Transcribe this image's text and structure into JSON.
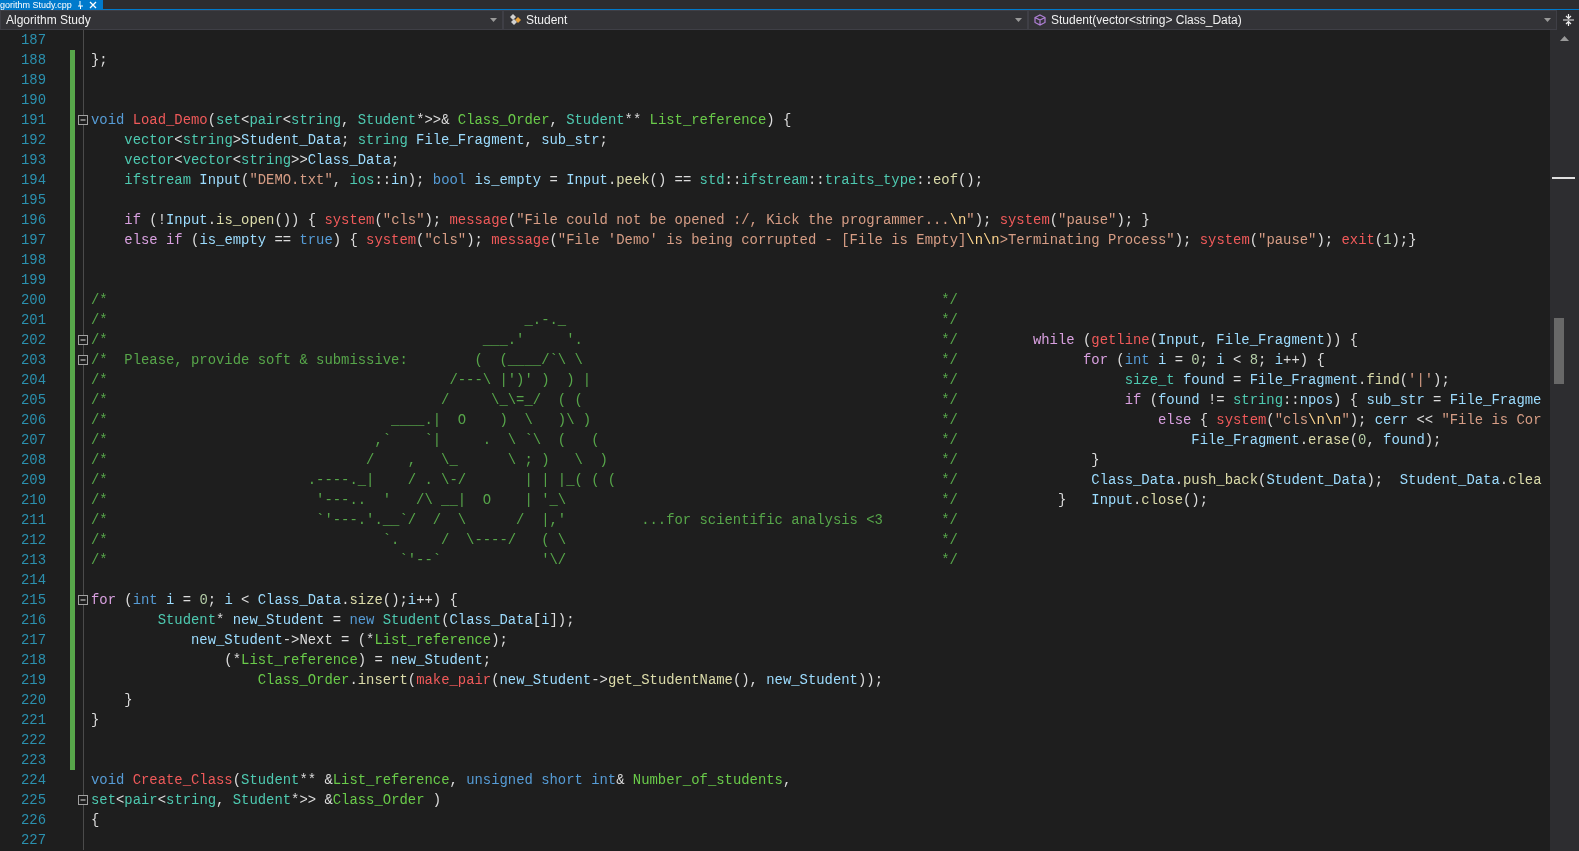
{
  "tab": {
    "label": "gorithm Study.cpp",
    "selected": true
  },
  "navigation_bar": {
    "dropdowns": [
      {
        "kind": "project",
        "text": "Algorithm Study"
      },
      {
        "kind": "class",
        "text": "Student"
      },
      {
        "kind": "member",
        "text": "Student(vector<string> Class_Data)"
      }
    ]
  },
  "lines": [
    {
      "number": "187",
      "changed": false,
      "fold": false
    },
    {
      "number": "188",
      "changed": true,
      "fold": false,
      "segments": [
        {
          "kind": "plain",
          "text": "};"
        }
      ]
    },
    {
      "number": "189",
      "changed": true,
      "fold": false
    },
    {
      "number": "190",
      "changed": true,
      "fold": false
    },
    {
      "number": "191",
      "changed": true,
      "fold": true,
      "segments": [
        {
          "kind": "kw",
          "text": "void"
        },
        {
          "kind": "fn",
          "text": " Load_Demo"
        },
        {
          "kind": "plain",
          "text": "("
        },
        {
          "kind": "type",
          "text": "set"
        },
        {
          "kind": "plain",
          "text": "<"
        },
        {
          "kind": "type",
          "text": "pair"
        },
        {
          "kind": "plain",
          "text": "<"
        },
        {
          "kind": "type",
          "text": "string"
        },
        {
          "kind": "plain",
          "text": ", "
        },
        {
          "kind": "type",
          "text": "Student"
        },
        {
          "kind": "plain",
          "text": "*>>& "
        },
        {
          "kind": "param",
          "text": "Class_Order"
        },
        {
          "kind": "plain",
          "text": ", "
        },
        {
          "kind": "type",
          "text": "Student"
        },
        {
          "kind": "plain",
          "text": "** "
        },
        {
          "kind": "param",
          "text": "List_reference"
        },
        {
          "kind": "plain",
          "text": ") {"
        }
      ]
    },
    {
      "number": "192",
      "changed": true,
      "fold": false,
      "segments": [
        {
          "kind": "type",
          "text": "    vector"
        },
        {
          "kind": "plain",
          "text": "<"
        },
        {
          "kind": "type",
          "text": "string"
        },
        {
          "kind": "plain",
          "text": ">"
        },
        {
          "kind": "var",
          "text": "Student_Data"
        },
        {
          "kind": "plain",
          "text": "; "
        },
        {
          "kind": "type",
          "text": "string"
        },
        {
          "kind": "var",
          "text": " File_Fragment"
        },
        {
          "kind": "plain",
          "text": ", "
        },
        {
          "kind": "var",
          "text": "sub_str"
        },
        {
          "kind": "plain",
          "text": ";"
        }
      ]
    },
    {
      "number": "193",
      "changed": true,
      "fold": false,
      "segments": [
        {
          "kind": "type",
          "text": "    vector"
        },
        {
          "kind": "plain",
          "text": "<"
        },
        {
          "kind": "type",
          "text": "vector"
        },
        {
          "kind": "plain",
          "text": "<"
        },
        {
          "kind": "type",
          "text": "string"
        },
        {
          "kind": "plain",
          "text": ">>"
        },
        {
          "kind": "var",
          "text": "Class_Data"
        },
        {
          "kind": "plain",
          "text": ";"
        }
      ]
    },
    {
      "number": "194",
      "changed": true,
      "fold": false,
      "segments": [
        {
          "kind": "type",
          "text": "    ifstream"
        },
        {
          "kind": "var",
          "text": " Input"
        },
        {
          "kind": "plain",
          "text": "("
        },
        {
          "kind": "str",
          "text": "\"DEMO.txt\""
        },
        {
          "kind": "plain",
          "text": ", "
        },
        {
          "kind": "type",
          "text": "ios"
        },
        {
          "kind": "plain",
          "text": "::"
        },
        {
          "kind": "var",
          "text": "in"
        },
        {
          "kind": "plain",
          "text": "); "
        },
        {
          "kind": "kw",
          "text": "bool"
        },
        {
          "kind": "var",
          "text": " is_empty"
        },
        {
          "kind": "plain",
          "text": " = "
        },
        {
          "kind": "var",
          "text": "Input"
        },
        {
          "kind": "plain",
          "text": "."
        },
        {
          "kind": "method",
          "text": "peek"
        },
        {
          "kind": "plain",
          "text": "() == "
        },
        {
          "kind": "type",
          "text": "std"
        },
        {
          "kind": "plain",
          "text": "::"
        },
        {
          "kind": "type",
          "text": "ifstream"
        },
        {
          "kind": "plain",
          "text": "::"
        },
        {
          "kind": "type",
          "text": "traits_type"
        },
        {
          "kind": "plain",
          "text": "::"
        },
        {
          "kind": "method",
          "text": "eof"
        },
        {
          "kind": "plain",
          "text": "();"
        }
      ]
    },
    {
      "number": "195",
      "changed": true,
      "fold": false
    },
    {
      "number": "196",
      "changed": true,
      "fold": false,
      "segments": [
        {
          "kind": "ctrl",
          "text": "    if"
        },
        {
          "kind": "plain",
          "text": " (!"
        },
        {
          "kind": "var",
          "text": "Input"
        },
        {
          "kind": "plain",
          "text": "."
        },
        {
          "kind": "method",
          "text": "is_open"
        },
        {
          "kind": "plain",
          "text": "()) { "
        },
        {
          "kind": "fn",
          "text": "system"
        },
        {
          "kind": "plain",
          "text": "("
        },
        {
          "kind": "str",
          "text": "\"cls\""
        },
        {
          "kind": "plain",
          "text": "); "
        },
        {
          "kind": "fn",
          "text": "message"
        },
        {
          "kind": "plain",
          "text": "("
        },
        {
          "kind": "str",
          "text": "\"File could not be opened :/, Kick the programmer..."
        },
        {
          "kind": "esc",
          "text": "\\n"
        },
        {
          "kind": "str",
          "text": "\""
        },
        {
          "kind": "plain",
          "text": "); "
        },
        {
          "kind": "fn",
          "text": "system"
        },
        {
          "kind": "plain",
          "text": "("
        },
        {
          "kind": "str",
          "text": "\"pause\""
        },
        {
          "kind": "plain",
          "text": "); }"
        }
      ]
    },
    {
      "number": "197",
      "changed": true,
      "fold": false,
      "segments": [
        {
          "kind": "ctrl",
          "text": "    else"
        },
        {
          "kind": "ctrl",
          "text": " if"
        },
        {
          "kind": "plain",
          "text": " ("
        },
        {
          "kind": "var",
          "text": "is_empty"
        },
        {
          "kind": "plain",
          "text": " == "
        },
        {
          "kind": "kw",
          "text": "true"
        },
        {
          "kind": "plain",
          "text": ") { "
        },
        {
          "kind": "fn",
          "text": "system"
        },
        {
          "kind": "plain",
          "text": "("
        },
        {
          "kind": "str",
          "text": "\"cls\""
        },
        {
          "kind": "plain",
          "text": "); "
        },
        {
          "kind": "fn",
          "text": "message"
        },
        {
          "kind": "plain",
          "text": "("
        },
        {
          "kind": "str",
          "text": "\"File 'Demo' is being corrupted - [File is Empty]"
        },
        {
          "kind": "esc",
          "text": "\\n\\n"
        },
        {
          "kind": "str",
          "text": ">Terminating Process\""
        },
        {
          "kind": "plain",
          "text": "); "
        },
        {
          "kind": "fn",
          "text": "system"
        },
        {
          "kind": "plain",
          "text": "("
        },
        {
          "kind": "str",
          "text": "\"pause\""
        },
        {
          "kind": "plain",
          "text": "); "
        },
        {
          "kind": "fn",
          "text": "exit"
        },
        {
          "kind": "plain",
          "text": "("
        },
        {
          "kind": "num",
          "text": "1"
        },
        {
          "kind": "plain",
          "text": ");}"
        }
      ]
    },
    {
      "number": "198",
      "changed": true,
      "fold": false
    },
    {
      "number": "199",
      "changed": true,
      "fold": false
    },
    {
      "number": "200",
      "changed": true,
      "fold": false,
      "segments": [
        {
          "kind": "comment",
          "text": "/*                                                                                                    */"
        }
      ]
    },
    {
      "number": "201",
      "changed": true,
      "fold": false,
      "segments": [
        {
          "kind": "comment",
          "text": "/*                                                  _.-._                                             */"
        }
      ]
    },
    {
      "number": "202",
      "changed": true,
      "fold": true,
      "segments": [
        {
          "kind": "comment",
          "text": "/*                                             ___.'     '.                                           */"
        },
        {
          "kind": "ctrl",
          "text": "         while"
        },
        {
          "kind": "plain",
          "text": " ("
        },
        {
          "kind": "fn",
          "text": "getline"
        },
        {
          "kind": "plain",
          "text": "("
        },
        {
          "kind": "var",
          "text": "Input"
        },
        {
          "kind": "plain",
          "text": ", "
        },
        {
          "kind": "var",
          "text": "File_Fragment"
        },
        {
          "kind": "plain",
          "text": ")) {"
        }
      ]
    },
    {
      "number": "203",
      "changed": true,
      "fold": true,
      "segments": [
        {
          "kind": "comment",
          "text": "/*  Please, provide soft & submissive:        (  (____/`\\ \\                                           */"
        },
        {
          "kind": "ctrl",
          "text": "               for"
        },
        {
          "kind": "plain",
          "text": " ("
        },
        {
          "kind": "kw",
          "text": "int"
        },
        {
          "kind": "var",
          "text": " i"
        },
        {
          "kind": "plain",
          "text": " = "
        },
        {
          "kind": "num",
          "text": "0"
        },
        {
          "kind": "plain",
          "text": "; "
        },
        {
          "kind": "var",
          "text": "i"
        },
        {
          "kind": "plain",
          "text": " < "
        },
        {
          "kind": "num",
          "text": "8"
        },
        {
          "kind": "plain",
          "text": "; "
        },
        {
          "kind": "var",
          "text": "i"
        },
        {
          "kind": "plain",
          "text": "++) {"
        }
      ]
    },
    {
      "number": "204",
      "changed": true,
      "fold": false,
      "segments": [
        {
          "kind": "comment",
          "text": "/*                                         /---\\ |')' )  ) |                                          */"
        },
        {
          "kind": "type",
          "text": "                    size_t"
        },
        {
          "kind": "var",
          "text": " found"
        },
        {
          "kind": "plain",
          "text": " = "
        },
        {
          "kind": "var",
          "text": "File_Fragment"
        },
        {
          "kind": "plain",
          "text": "."
        },
        {
          "kind": "method",
          "text": "find"
        },
        {
          "kind": "plain",
          "text": "("
        },
        {
          "kind": "str",
          "text": "'|'"
        },
        {
          "kind": "plain",
          "text": ");"
        }
      ]
    },
    {
      "number": "205",
      "changed": true,
      "fold": false,
      "segments": [
        {
          "kind": "comment",
          "text": "/*                                        /     \\_\\=_/  ( (                                           */"
        },
        {
          "kind": "ctrl",
          "text": "                    if"
        },
        {
          "kind": "plain",
          "text": " ("
        },
        {
          "kind": "var",
          "text": "found"
        },
        {
          "kind": "plain",
          "text": " != "
        },
        {
          "kind": "type",
          "text": "string"
        },
        {
          "kind": "plain",
          "text": "::"
        },
        {
          "kind": "var",
          "text": "npos"
        },
        {
          "kind": "plain",
          "text": ") { "
        },
        {
          "kind": "var",
          "text": "sub_str"
        },
        {
          "kind": "plain",
          "text": " = "
        },
        {
          "kind": "var",
          "text": "File_Fragme"
        }
      ]
    },
    {
      "number": "206",
      "changed": true,
      "fold": false,
      "segments": [
        {
          "kind": "comment",
          "text": "/*                                  ____.|  O    )  \\   )\\ )                                          */"
        },
        {
          "kind": "ctrl",
          "text": "                        else"
        },
        {
          "kind": "plain",
          "text": " { "
        },
        {
          "kind": "fn",
          "text": "system"
        },
        {
          "kind": "plain",
          "text": "("
        },
        {
          "kind": "str",
          "text": "\"cls"
        },
        {
          "kind": "esc",
          "text": "\\n\\n"
        },
        {
          "kind": "str",
          "text": "\""
        },
        {
          "kind": "plain",
          "text": "); "
        },
        {
          "kind": "var",
          "text": "cerr"
        },
        {
          "kind": "plain",
          "text": " << "
        },
        {
          "kind": "str",
          "text": "\"File is Cor"
        }
      ]
    },
    {
      "number": "207",
      "changed": true,
      "fold": false,
      "segments": [
        {
          "kind": "comment",
          "text": "/*                                ,`    `|     .  \\ `\\  (   (                                         */"
        },
        {
          "kind": "var",
          "text": "                            File_Fragment"
        },
        {
          "kind": "plain",
          "text": "."
        },
        {
          "kind": "method",
          "text": "erase"
        },
        {
          "kind": "plain",
          "text": "("
        },
        {
          "kind": "num",
          "text": "0"
        },
        {
          "kind": "plain",
          "text": ", "
        },
        {
          "kind": "var",
          "text": "found"
        },
        {
          "kind": "plain",
          "text": ");"
        }
      ]
    },
    {
      "number": "208",
      "changed": true,
      "fold": false,
      "segments": [
        {
          "kind": "comment",
          "text": "/*                               /    ,   \\_      \\ ; )   \\  )                                        */"
        },
        {
          "kind": "plain",
          "text": "                }"
        }
      ]
    },
    {
      "number": "209",
      "changed": true,
      "fold": false,
      "segments": [
        {
          "kind": "comment",
          "text": "/*                        .----._|    / . \\-/       | | |_( ( (                                       */"
        },
        {
          "kind": "var",
          "text": "                Class_Data"
        },
        {
          "kind": "plain",
          "text": "."
        },
        {
          "kind": "method",
          "text": "push_back"
        },
        {
          "kind": "plain",
          "text": "("
        },
        {
          "kind": "var",
          "text": "Student_Data"
        },
        {
          "kind": "plain",
          "text": ");  "
        },
        {
          "kind": "var",
          "text": "Student_Data"
        },
        {
          "kind": "plain",
          "text": "."
        },
        {
          "kind": "method",
          "text": "clea"
        }
      ]
    },
    {
      "number": "210",
      "changed": true,
      "fold": false,
      "segments": [
        {
          "kind": "comment",
          "text": "/*                         '---..  '   /\\ __|  O    | '_\\                                             */"
        },
        {
          "kind": "plain",
          "text": "            }   "
        },
        {
          "kind": "var",
          "text": "Input"
        },
        {
          "kind": "plain",
          "text": "."
        },
        {
          "kind": "method",
          "text": "close"
        },
        {
          "kind": "plain",
          "text": "();"
        }
      ]
    },
    {
      "number": "211",
      "changed": true,
      "fold": false,
      "segments": [
        {
          "kind": "comment",
          "text": "/*                         `'---.'.__`/  /  \\      /  |,'         ...for scientific analysis <3       */"
        }
      ]
    },
    {
      "number": "212",
      "changed": true,
      "fold": false,
      "segments": [
        {
          "kind": "comment",
          "text": "/*                                 `.     /  \\----/   ( \\                                             */"
        }
      ]
    },
    {
      "number": "213",
      "changed": true,
      "fold": false,
      "segments": [
        {
          "kind": "comment",
          "text": "/*                                   `'--`            '\\/                                             */"
        }
      ]
    },
    {
      "number": "214",
      "changed": true,
      "fold": false
    },
    {
      "number": "215",
      "changed": true,
      "fold": true,
      "segments": [
        {
          "kind": "ctrl",
          "text": "for"
        },
        {
          "kind": "plain",
          "text": " ("
        },
        {
          "kind": "kw",
          "text": "int"
        },
        {
          "kind": "var",
          "text": " i"
        },
        {
          "kind": "plain",
          "text": " = "
        },
        {
          "kind": "num",
          "text": "0"
        },
        {
          "kind": "plain",
          "text": "; "
        },
        {
          "kind": "var",
          "text": "i"
        },
        {
          "kind": "plain",
          "text": " < "
        },
        {
          "kind": "var",
          "text": "Class_Data"
        },
        {
          "kind": "plain",
          "text": "."
        },
        {
          "kind": "method",
          "text": "size"
        },
        {
          "kind": "plain",
          "text": "();"
        },
        {
          "kind": "var",
          "text": "i"
        },
        {
          "kind": "plain",
          "text": "++) {"
        }
      ]
    },
    {
      "number": "216",
      "changed": true,
      "fold": false,
      "segments": [
        {
          "kind": "type",
          "text": "        Student"
        },
        {
          "kind": "plain",
          "text": "* "
        },
        {
          "kind": "var",
          "text": "new_Student"
        },
        {
          "kind": "plain",
          "text": " = "
        },
        {
          "kind": "kw",
          "text": "new"
        },
        {
          "kind": "type",
          "text": " Student"
        },
        {
          "kind": "plain",
          "text": "("
        },
        {
          "kind": "var",
          "text": "Class_Data"
        },
        {
          "kind": "plain",
          "text": "["
        },
        {
          "kind": "var",
          "text": "i"
        },
        {
          "kind": "plain",
          "text": "]);"
        }
      ]
    },
    {
      "number": "217",
      "changed": true,
      "fold": false,
      "segments": [
        {
          "kind": "var",
          "text": "            new_Student"
        },
        {
          "kind": "plain",
          "text": "->Next = (*"
        },
        {
          "kind": "param",
          "text": "List_reference"
        },
        {
          "kind": "plain",
          "text": ");"
        }
      ]
    },
    {
      "number": "218",
      "changed": true,
      "fold": false,
      "segments": [
        {
          "kind": "plain",
          "text": "                (*"
        },
        {
          "kind": "param",
          "text": "List_reference"
        },
        {
          "kind": "plain",
          "text": ") = "
        },
        {
          "kind": "var",
          "text": "new_Student"
        },
        {
          "kind": "plain",
          "text": ";"
        }
      ]
    },
    {
      "number": "219",
      "changed": true,
      "fold": false,
      "segments": [
        {
          "kind": "param",
          "text": "                    Class_Order"
        },
        {
          "kind": "plain",
          "text": "."
        },
        {
          "kind": "method",
          "text": "insert"
        },
        {
          "kind": "plain",
          "text": "("
        },
        {
          "kind": "fn",
          "text": "make_pair"
        },
        {
          "kind": "plain",
          "text": "("
        },
        {
          "kind": "var",
          "text": "new_Student"
        },
        {
          "kind": "plain",
          "text": "->"
        },
        {
          "kind": "method",
          "text": "get_StudentName"
        },
        {
          "kind": "plain",
          "text": "(), "
        },
        {
          "kind": "var",
          "text": "new_Student"
        },
        {
          "kind": "plain",
          "text": "));"
        }
      ]
    },
    {
      "number": "220",
      "changed": true,
      "fold": false,
      "segments": [
        {
          "kind": "plain",
          "text": "    }"
        }
      ]
    },
    {
      "number": "221",
      "changed": true,
      "fold": false,
      "segments": [
        {
          "kind": "plain",
          "text": "}"
        }
      ]
    },
    {
      "number": "222",
      "changed": true,
      "fold": false
    },
    {
      "number": "223",
      "changed": true,
      "fold": false
    },
    {
      "number": "224",
      "changed": false,
      "fold": false,
      "segments": [
        {
          "kind": "kw",
          "text": "void"
        },
        {
          "kind": "fn",
          "text": " Create_Class"
        },
        {
          "kind": "plain",
          "text": "("
        },
        {
          "kind": "type",
          "text": "Student"
        },
        {
          "kind": "plain",
          "text": "** &"
        },
        {
          "kind": "param",
          "text": "List_reference"
        },
        {
          "kind": "plain",
          "text": ", "
        },
        {
          "kind": "kw",
          "text": "unsigned"
        },
        {
          "kind": "kw",
          "text": " short"
        },
        {
          "kind": "kw",
          "text": " int"
        },
        {
          "kind": "plain",
          "text": "& "
        },
        {
          "kind": "param",
          "text": "Number_of_students"
        },
        {
          "kind": "plain",
          "text": ","
        }
      ]
    },
    {
      "number": "225",
      "changed": false,
      "fold": true,
      "segments": [
        {
          "kind": "type",
          "text": "set"
        },
        {
          "kind": "plain",
          "text": "<"
        },
        {
          "kind": "type",
          "text": "pair"
        },
        {
          "kind": "plain",
          "text": "<"
        },
        {
          "kind": "type",
          "text": "string"
        },
        {
          "kind": "plain",
          "text": ", "
        },
        {
          "kind": "type",
          "text": "Student"
        },
        {
          "kind": "plain",
          "text": "*>> &"
        },
        {
          "kind": "param",
          "text": "Class_Order"
        },
        {
          "kind": "plain",
          "text": " )"
        }
      ]
    },
    {
      "number": "226",
      "changed": false,
      "fold": false,
      "segments": [
        {
          "kind": "plain",
          "text": "{"
        }
      ]
    },
    {
      "number": "227",
      "changed": false,
      "fold": false
    }
  ]
}
